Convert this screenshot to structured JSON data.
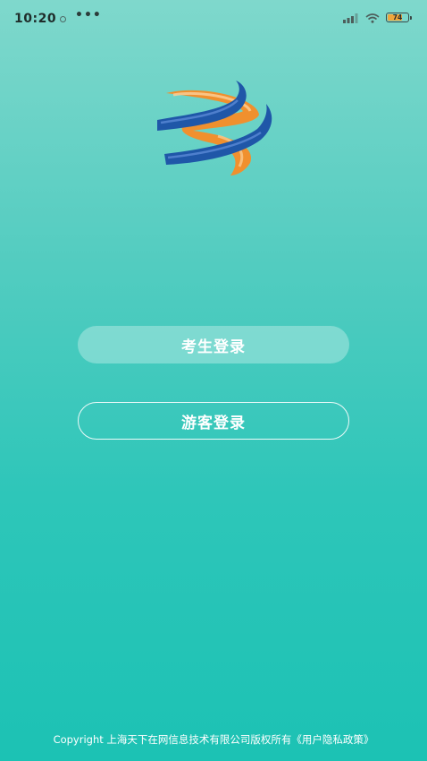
{
  "status_bar": {
    "time": "10:20",
    "more": "•••",
    "battery_level": "74"
  },
  "login": {
    "student_label": "考生登录",
    "guest_label": "游客登录"
  },
  "footer": {
    "copyright_text": "Copyright  上海天下在网信息技术有限公司版权所有",
    "policy_link": "《用户隐私政策》"
  },
  "colors": {
    "background_top": "#7fd8cc",
    "background_bottom": "#1cc2b4",
    "logo_blue": "#1f57a8",
    "logo_orange": "#f0902e"
  }
}
